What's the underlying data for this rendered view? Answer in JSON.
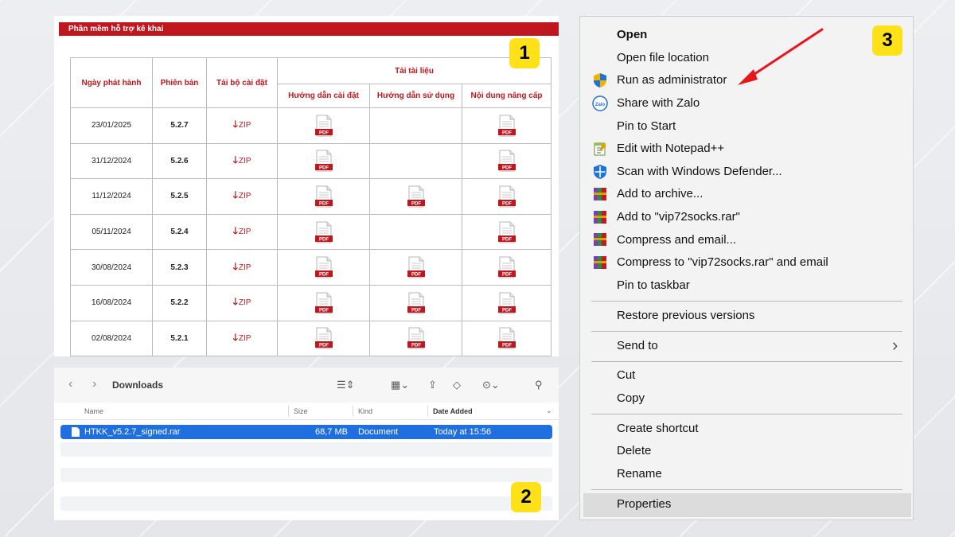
{
  "software_table": {
    "header_title": "Phần mềm hỗ trợ kê khai",
    "columns": {
      "release_date": "Ngày phát hành",
      "version": "Phiên bản",
      "installer": "Tải bộ cài đặt",
      "documents": "Tải tài liệu",
      "install_guide": "Hướng dẫn cài đặt",
      "user_guide": "Hướng dẫn sử dụng",
      "upgrade_notes": "Nội dung nâng cấp"
    },
    "zip_label": "ZIP",
    "pdf_label": "PDF",
    "rows": [
      {
        "date": "23/01/2025",
        "version": "5.2.7",
        "install_guide": true,
        "user_guide": false,
        "upgrade_notes": true
      },
      {
        "date": "31/12/2024",
        "version": "5.2.6",
        "install_guide": true,
        "user_guide": false,
        "upgrade_notes": true
      },
      {
        "date": "11/12/2024",
        "version": "5.2.5",
        "install_guide": true,
        "user_guide": true,
        "upgrade_notes": true
      },
      {
        "date": "05/11/2024",
        "version": "5.2.4",
        "install_guide": true,
        "user_guide": false,
        "upgrade_notes": true
      },
      {
        "date": "30/08/2024",
        "version": "5.2.3",
        "install_guide": true,
        "user_guide": true,
        "upgrade_notes": true
      },
      {
        "date": "16/08/2024",
        "version": "5.2.2",
        "install_guide": true,
        "user_guide": true,
        "upgrade_notes": true
      },
      {
        "date": "02/08/2024",
        "version": "5.2.1",
        "install_guide": true,
        "user_guide": true,
        "upgrade_notes": true
      }
    ]
  },
  "finder": {
    "title": "Downloads",
    "columns": {
      "name": "Name",
      "size": "Size",
      "kind": "Kind",
      "date_added": "Date Added"
    },
    "files": [
      {
        "name": "HTKK_v5.2.7_signed.rar",
        "size": "68,7 MB",
        "kind": "Document",
        "date_added": "Today at 15:56"
      }
    ]
  },
  "context_menu": {
    "items": [
      {
        "label": "Open",
        "icon": "none"
      },
      {
        "label": "Open file location",
        "icon": "none"
      },
      {
        "label": "Run as administrator",
        "icon": "uac-shield-icon"
      },
      {
        "label": "Share with Zalo",
        "icon": "zalo-icon"
      },
      {
        "label": "Pin to Start",
        "icon": "none"
      },
      {
        "label": "Edit with Notepad++",
        "icon": "notepad-plus-plus-icon"
      },
      {
        "label": "Scan with Windows Defender...",
        "icon": "windows-defender-icon"
      },
      {
        "label": "Add to archive...",
        "icon": "winrar-icon"
      },
      {
        "label": "Add to \"vip72socks.rar\"",
        "icon": "winrar-icon"
      },
      {
        "label": "Compress and email...",
        "icon": "winrar-icon"
      },
      {
        "label": "Compress to \"vip72socks.rar\" and email",
        "icon": "winrar-icon"
      },
      {
        "label": "Pin to taskbar",
        "icon": "none"
      },
      {
        "label": "Restore previous versions",
        "icon": "none"
      },
      {
        "label": "Send to",
        "icon": "none"
      },
      {
        "label": "Cut",
        "icon": "none"
      },
      {
        "label": "Copy",
        "icon": "none"
      },
      {
        "label": "Create shortcut",
        "icon": "none"
      },
      {
        "label": "Delete",
        "icon": "none"
      },
      {
        "label": "Rename",
        "icon": "none"
      },
      {
        "label": "Properties",
        "icon": "none"
      }
    ],
    "send_to_arrow": "›",
    "highlighted": "Properties",
    "annotation_arrow_color": "#e8161b"
  },
  "badges": {
    "panel1": "1",
    "panel2": "2",
    "panel3": "3"
  },
  "colors": {
    "brand_red": "#c0161d",
    "finder_selection": "#1f6fe0",
    "badge_yellow": "#ffe11a"
  }
}
